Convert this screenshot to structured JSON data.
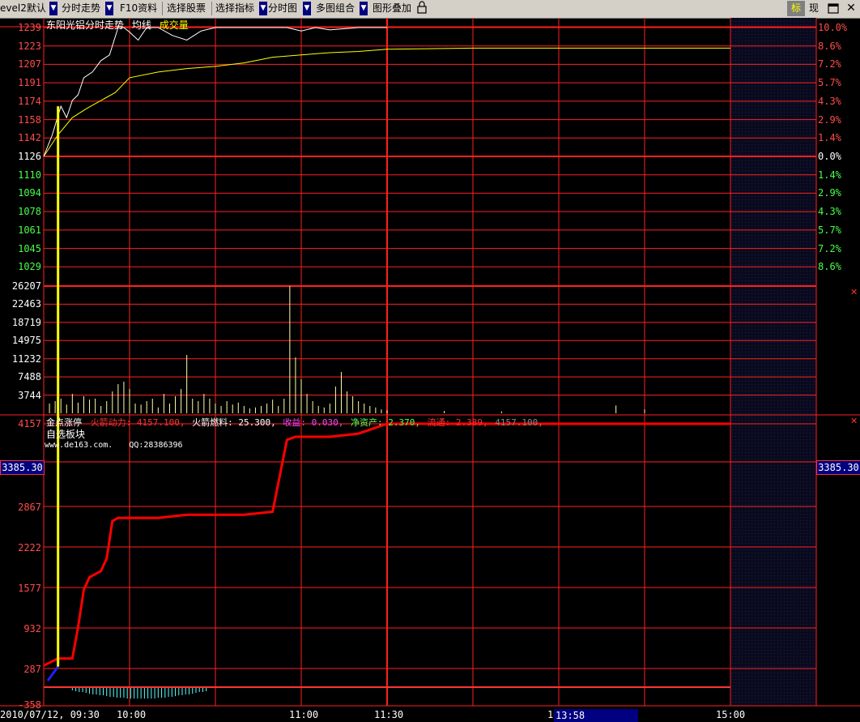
{
  "toolbar": {
    "level_default": "evel2默认",
    "minute_trend": "分时走势",
    "f10": "F10资料",
    "select_stock": "选择股票",
    "select_indicator": "选择指标",
    "minute_chart": "分时图",
    "multi_chart": "多图组合",
    "chart_overlay": "图形叠加",
    "mark": "标",
    "current": "现"
  },
  "price_panel": {
    "title": "东阳光铝分时走势",
    "avg_label": "均线",
    "volume_label": "成交量",
    "prices_up": [
      "1239",
      "1223",
      "1207",
      "1191",
      "1174",
      "1158",
      "1142"
    ],
    "price_base": "1126",
    "prices_down": [
      "1110",
      "1094",
      "1078",
      "1061",
      "1045",
      "1029"
    ],
    "pct_up": [
      "10.0%",
      "8.6%",
      "7.2%",
      "5.7%",
      "4.3%",
      "2.9%",
      "1.4%"
    ],
    "pct_base": "0.0%",
    "pct_down": [
      "1.4%",
      "2.9%",
      "4.3%",
      "5.7%",
      "7.2%",
      "8.6%"
    ]
  },
  "volume_panel": {
    "ticks": [
      "26207",
      "22463",
      "18719",
      "14975",
      "11232",
      "7488",
      "3744"
    ]
  },
  "indicator_panel": {
    "name": "金点涨停",
    "rocket_power_label": "火箭动力:",
    "rocket_power_value": "4157.100,",
    "rocket_fuel_label": "火箭燃料:",
    "rocket_fuel_value": "25.300,",
    "income_label": "收益:",
    "income_value": "0.030,",
    "net_assets_label": "净资产:",
    "net_assets_value": "2.370,",
    "float_label": "流通:",
    "float_value": "2.389,",
    "last_value": "4157.100,",
    "sector_label": "自选板块",
    "website": "www.de163.com.",
    "qq": "QQ:28386396",
    "ticks": [
      "4157",
      "2867",
      "2222",
      "1577",
      "932",
      "287",
      "-358"
    ],
    "cursor_value_left": "3385.30",
    "cursor_value_right": "3385.30"
  },
  "time_axis": {
    "cursor_datetime": "2010/07/12, 09:30",
    "t1000": "10:00",
    "t1100": "11:00",
    "t1130": "11:30",
    "t14": "14",
    "cursor_time": "13:58",
    "t1500": "15:00"
  },
  "colors": {
    "price_line": "#ffffff",
    "avg_line": "#ffff00",
    "grid_red": "#ff2020",
    "indicator_line": "#ff0000",
    "yellow_bar": "#ffff00",
    "cyan_bars": "#55ffff"
  },
  "chart_data": [
    {
      "type": "line",
      "title": "东阳光铝分时走势",
      "series": [
        {
          "name": "分时走势",
          "x_minutes": [
            0,
            3,
            6,
            8,
            10,
            12,
            14,
            17,
            20,
            23,
            26,
            28,
            30,
            33,
            36,
            40,
            45,
            50,
            55,
            60,
            70,
            75,
            80,
            85,
            90,
            95,
            100,
            110,
            120
          ],
          "y": [
            1126,
            1145,
            1170,
            1160,
            1175,
            1180,
            1195,
            1200,
            1210,
            1215,
            1239,
            1239,
            1235,
            1228,
            1239,
            1239,
            1232,
            1228,
            1236,
            1239,
            1239,
            1239,
            1239,
            1239,
            1236,
            1239,
            1237,
            1239,
            1239
          ]
        },
        {
          "name": "均线",
          "x_minutes": [
            0,
            5,
            10,
            15,
            20,
            25,
            30,
            40,
            50,
            60,
            70,
            80,
            90,
            100,
            110,
            120,
            150,
            200,
            240
          ],
          "y": [
            1126,
            1145,
            1160,
            1168,
            1175,
            1182,
            1195,
            1200,
            1203,
            1205,
            1208,
            1213,
            1215,
            1217,
            1218,
            1220,
            1221,
            1221,
            1221
          ]
        }
      ],
      "ylim": [
        1029,
        1239
      ],
      "base_price": 1126
    },
    {
      "type": "bar",
      "title": "成交量",
      "ylim": [
        0,
        26207
      ],
      "x_minutes": [
        2,
        4,
        6,
        8,
        10,
        12,
        14,
        16,
        18,
        20,
        22,
        24,
        26,
        28,
        30,
        32,
        34,
        36,
        38,
        40,
        42,
        44,
        46,
        48,
        50,
        52,
        54,
        56,
        58,
        60,
        62,
        64,
        66,
        68,
        70,
        72,
        74,
        76,
        78,
        80,
        82,
        84,
        86,
        88,
        90,
        92,
        94,
        96,
        98,
        100,
        102,
        104,
        106,
        108,
        110,
        112,
        114,
        116,
        118,
        120,
        140,
        160,
        200,
        210
      ],
      "values": [
        2000,
        2500,
        3000,
        1800,
        4000,
        2200,
        3500,
        2800,
        3000,
        1500,
        2500,
        4500,
        6000,
        6500,
        5000,
        2000,
        1800,
        2500,
        3000,
        1200,
        4000,
        2000,
        3500,
        5000,
        12000,
        3000,
        2500,
        4000,
        3000,
        2000,
        1500,
        2500,
        1800,
        2200,
        1500,
        1000,
        1200,
        1500,
        2000,
        2800,
        1500,
        3000,
        26207,
        11500,
        7000,
        4000,
        2500,
        1500,
        1200,
        2000,
        5500,
        8500,
        4500,
        3500,
        2500,
        2000,
        1500,
        1200,
        800,
        600,
        500,
        400,
        1600,
        800
      ]
    },
    {
      "type": "line",
      "title": "金点涨停",
      "series": [
        {
          "name": "火箭动力",
          "x_minutes": [
            0,
            5,
            10,
            12,
            14,
            16,
            18,
            20,
            22,
            24,
            26,
            28,
            30,
            40,
            50,
            60,
            70,
            80,
            85,
            88,
            90,
            92,
            100,
            110,
            120,
            240
          ],
          "y": [
            287,
            400,
            400,
            900,
            1500,
            1700,
            1750,
            1800,
            2000,
            2600,
            2650,
            2650,
            2650,
            2650,
            2700,
            2700,
            2700,
            2750,
            3900,
            3950,
            3950,
            3950,
            3950,
            4000,
            4157,
            4157
          ]
        }
      ],
      "ylim": [
        -358,
        4157
      ]
    }
  ]
}
